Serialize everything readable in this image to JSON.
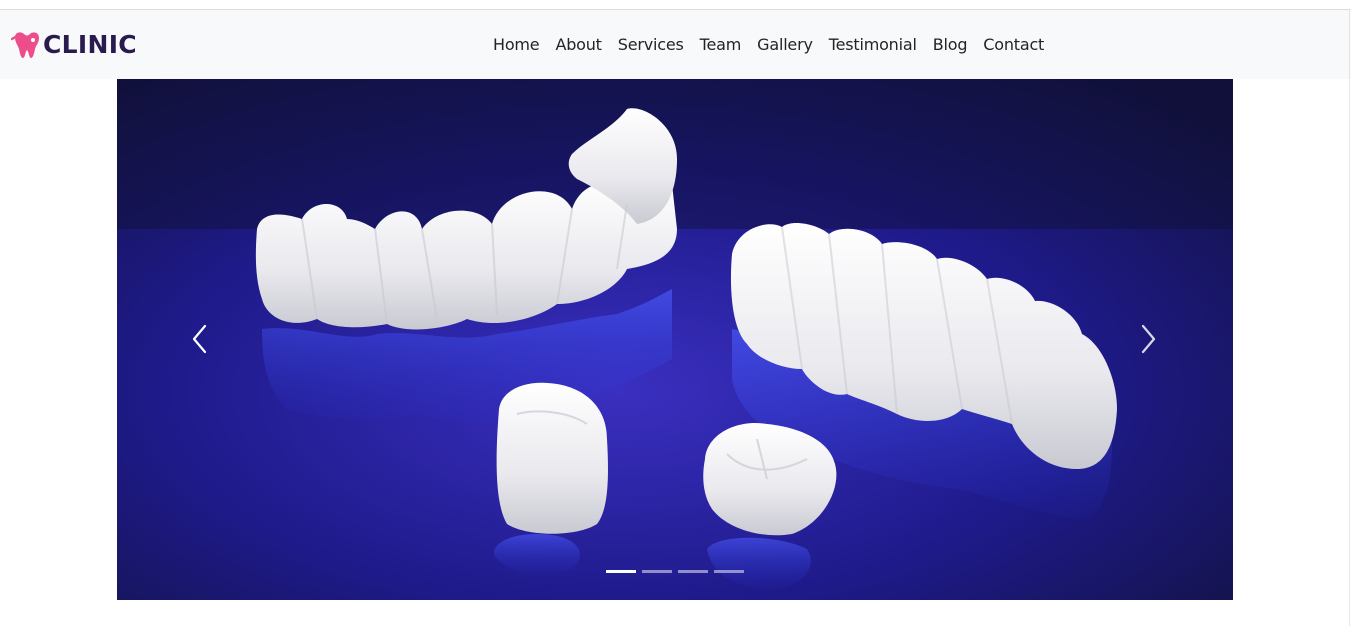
{
  "brand": {
    "name": "CLINIC",
    "icon": "tooth-icon",
    "icon_color": "#ee4d8b",
    "text_color": "#2a1a4e"
  },
  "nav": {
    "items": [
      {
        "label": "Home"
      },
      {
        "label": "About"
      },
      {
        "label": "Services"
      },
      {
        "label": "Team"
      },
      {
        "label": "Gallery"
      },
      {
        "label": "Testimonial"
      },
      {
        "label": "Blog"
      },
      {
        "label": "Contact"
      }
    ]
  },
  "carousel": {
    "slide_count": 4,
    "active_index": 0,
    "prev_icon": "chevron-left-icon",
    "next_icon": "chevron-right-icon",
    "background_color": "#1b1b72"
  }
}
